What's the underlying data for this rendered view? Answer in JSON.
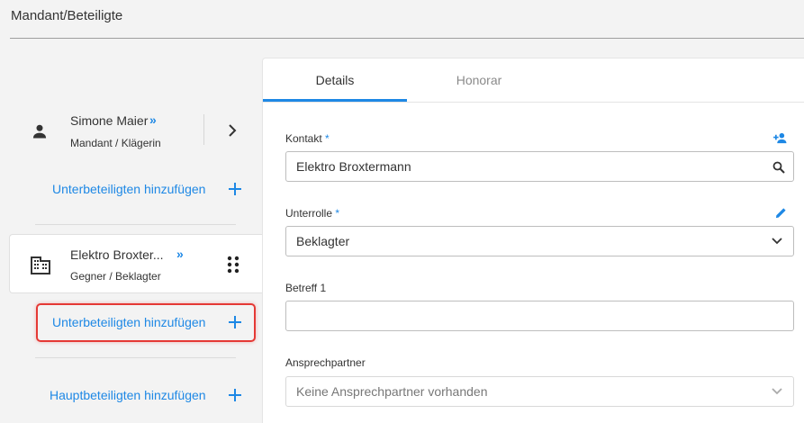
{
  "page": {
    "title": "Mandant/Beteiligte"
  },
  "parties": [
    {
      "name": "Simone Maier",
      "role": "Mandant / Klägerin",
      "expand_glyph": "»"
    },
    {
      "name": "Elektro Broxter...",
      "role": "Gegner / Beklagter",
      "expand_glyph": "»"
    }
  ],
  "links": {
    "add_sub_1": "Unterbeteiligten hinzufügen",
    "add_sub_2": "Unterbeteiligten hinzufügen",
    "add_main": "Hauptbeteiligten hinzufügen"
  },
  "tabs": [
    {
      "label": "Details",
      "active": true
    },
    {
      "label": "Honorar",
      "active": false
    }
  ],
  "form": {
    "kontakt": {
      "label": "Kontakt",
      "required": "*",
      "value": "Elektro Broxtermann"
    },
    "unterrolle": {
      "label": "Unterrolle",
      "required": "*",
      "value": "Beklagter"
    },
    "betreff": {
      "label": "Betreff 1",
      "value": ""
    },
    "ansprechpartner": {
      "label": "Ansprechpartner",
      "value": "Keine Ansprechpartner vorhanden"
    }
  },
  "colors": {
    "accent": "#1e88e5",
    "highlight": "#e53935",
    "text": "#333333"
  },
  "icons": [
    "person-icon",
    "building-icon",
    "chevron-right-icon",
    "drag-handle-icon",
    "plus-icon",
    "add-person-icon",
    "search-icon",
    "edit-icon",
    "chevron-down-icon"
  ]
}
